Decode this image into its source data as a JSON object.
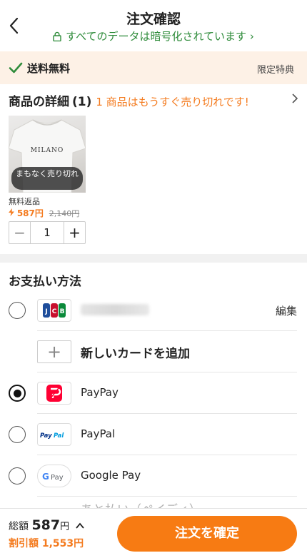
{
  "header": {
    "back_icon": "chevron-left-icon",
    "title": "注文確認",
    "secure_text": "すべてのデータは暗号化されています",
    "secure_chevron": "›"
  },
  "shipping": {
    "label": "送料無料",
    "perk": "限定特典"
  },
  "product": {
    "title": "商品の詳細",
    "count": "(1)",
    "warning": "1 商品はもうすぐ売り切れです!",
    "image_brand_text": "MILANO",
    "image_overlay": "まもなく売り切れ",
    "free_return": "無料返品",
    "price_now": "587円",
    "price_old": "2,140円",
    "quantity": "1",
    "accent_color": "#f47b1f"
  },
  "payment": {
    "title": "お支払い方法",
    "methods": [
      {
        "name": "",
        "logo": "jcb-logo",
        "selected": false,
        "edit_label": "編集"
      },
      {
        "name": "新しいカードを追加",
        "logo": "plus-icon",
        "selected": null
      },
      {
        "name": "PayPay",
        "logo": "paypay-logo",
        "selected": true
      },
      {
        "name": "PayPal",
        "logo": "paypal-logo",
        "selected": false
      },
      {
        "name": "Google Pay",
        "logo": "google-pay-logo",
        "selected": false
      }
    ],
    "partial_next": "あと払い（ペイディ）"
  },
  "footer": {
    "total_label": "総額",
    "total_amount": "587",
    "total_unit": "円",
    "discount_label": "割引額",
    "discount_amount": "1,553円",
    "confirm_label": "注文を確定",
    "confirm_color": "#f77b13"
  }
}
